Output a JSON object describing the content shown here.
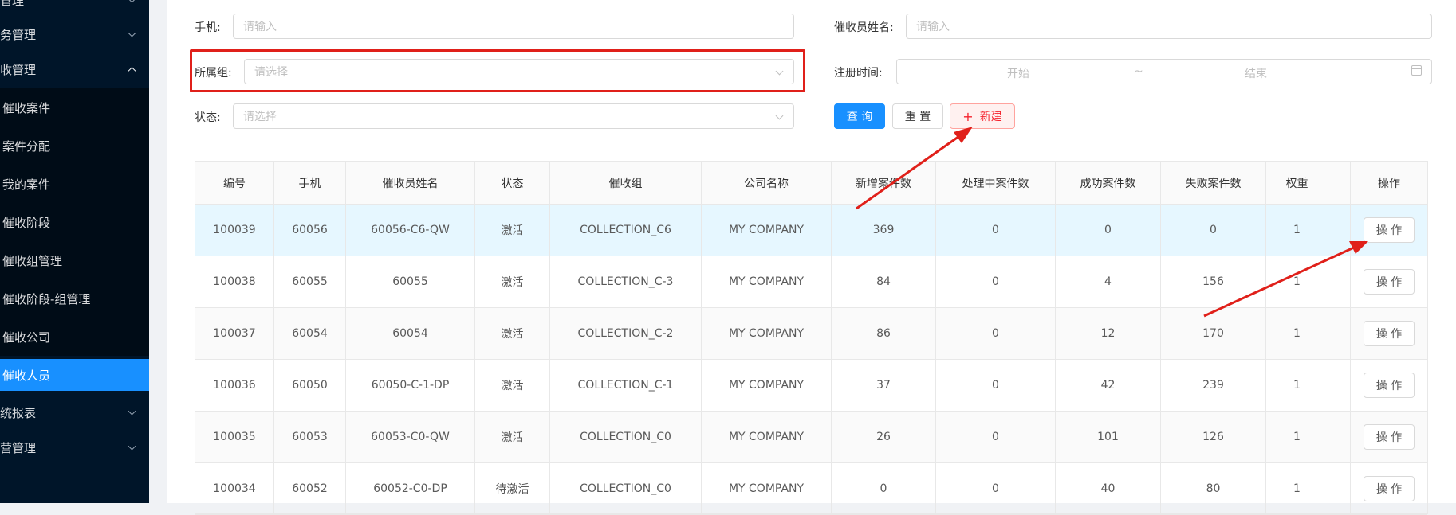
{
  "sidebar": {
    "items": [
      {
        "label": "管理",
        "chevron": "down"
      },
      {
        "label": "务管理",
        "chevron": "down"
      },
      {
        "label": "收管理",
        "chevron": "up"
      },
      {
        "label": "催收案件"
      },
      {
        "label": "案件分配"
      },
      {
        "label": "我的案件"
      },
      {
        "label": "催收阶段"
      },
      {
        "label": "催收组管理"
      },
      {
        "label": "催收阶段-组管理"
      },
      {
        "label": "催收公司"
      },
      {
        "label": "催收人员",
        "active": true
      },
      {
        "label": "统报表",
        "chevron": "down"
      },
      {
        "label": "营管理",
        "chevron": "down"
      }
    ]
  },
  "filters": {
    "phone_label": "手机:",
    "phone_placeholder": "请输入",
    "collector_name_label": "催收员姓名:",
    "collector_name_placeholder": "请输入",
    "group_label": "所属组:",
    "group_placeholder": "请选择",
    "reg_time_label": "注册时间:",
    "reg_start": "开始",
    "reg_sep": "~",
    "reg_end": "结束",
    "status_label": "状态:",
    "status_placeholder": "请选择"
  },
  "actions": {
    "query": "查 询",
    "reset": "重 置",
    "new_plus": "+",
    "new": "新建"
  },
  "table": {
    "headers": [
      "编号",
      "手机",
      "催收员姓名",
      "状态",
      "催收组",
      "公司名称",
      "新增案件数",
      "处理中案件数",
      "成功案件数",
      "失败案件数",
      "权重",
      "",
      "操作"
    ],
    "op_label": "操 作",
    "rows": [
      [
        "100039",
        "60056",
        "60056-C6-QW",
        "激活",
        "COLLECTION_C6",
        "MY COMPANY",
        "369",
        "0",
        "0",
        "0",
        "1"
      ],
      [
        "100038",
        "60055",
        "60055",
        "激活",
        "COLLECTION_C-3",
        "MY COMPANY",
        "84",
        "0",
        "4",
        "156",
        "1"
      ],
      [
        "100037",
        "60054",
        "60054",
        "激活",
        "COLLECTION_C-2",
        "MY COMPANY",
        "86",
        "0",
        "12",
        "170",
        "1"
      ],
      [
        "100036",
        "60050",
        "60050-C-1-DP",
        "激活",
        "COLLECTION_C-1",
        "MY COMPANY",
        "37",
        "0",
        "42",
        "239",
        "1"
      ],
      [
        "100035",
        "60053",
        "60053-C0-QW",
        "激活",
        "COLLECTION_C0",
        "MY COMPANY",
        "26",
        "0",
        "101",
        "126",
        "1"
      ],
      [
        "100034",
        "60052",
        "60052-C0-DP",
        "待激活",
        "COLLECTION_C0",
        "MY COMPANY",
        "0",
        "0",
        "40",
        "80",
        "1"
      ]
    ]
  },
  "colors": {
    "sidebar_bg": "#001529",
    "active": "#1890ff",
    "annotation_red": "#e0201a",
    "highlight_row": "#e6f7ff"
  }
}
